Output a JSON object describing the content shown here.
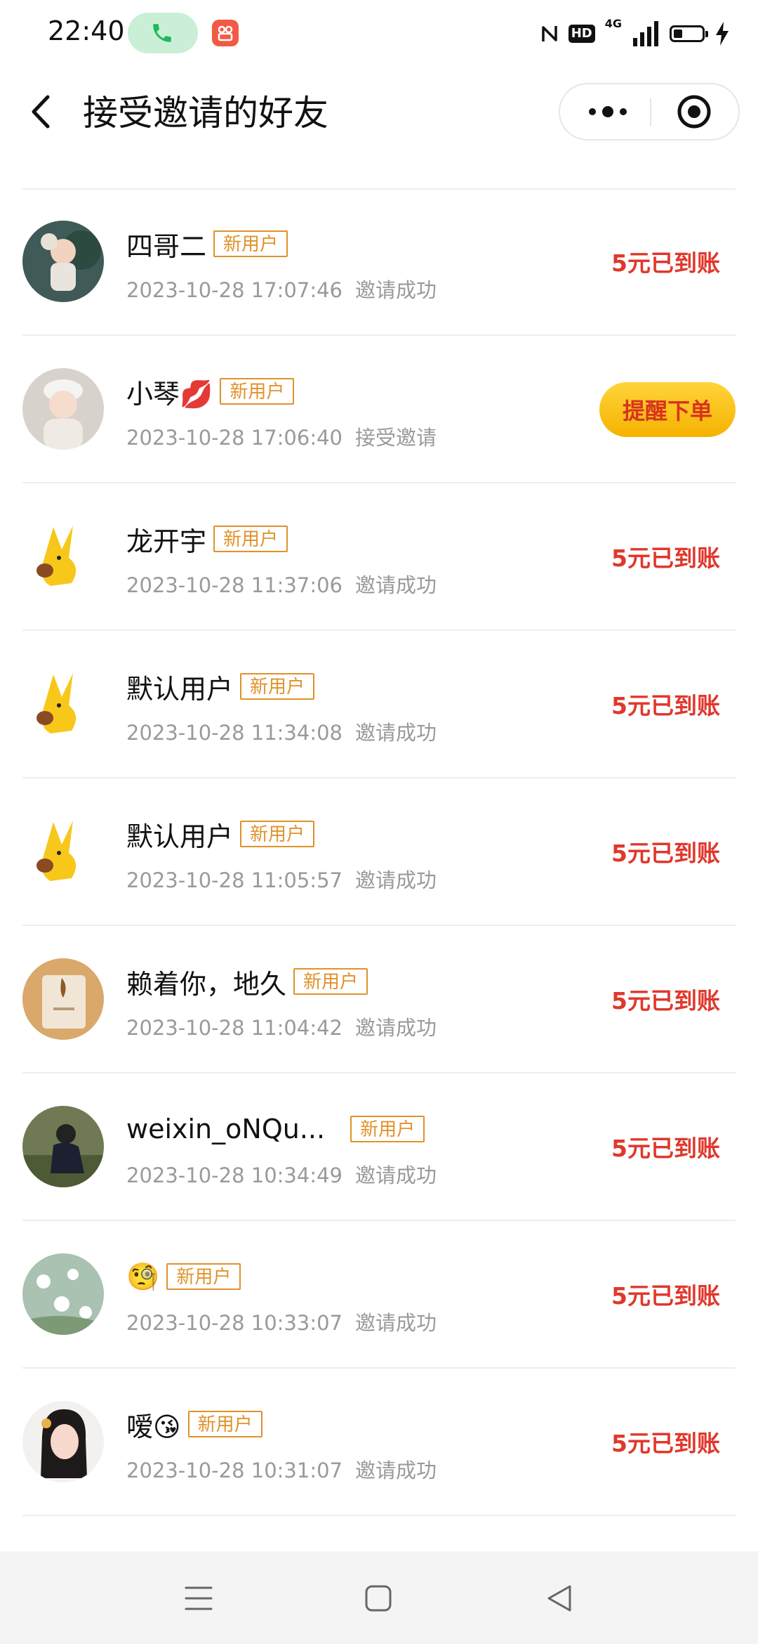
{
  "status_bar": {
    "time": "22:40",
    "hd": "HD",
    "network": "4G"
  },
  "header": {
    "title": "接受邀请的好友"
  },
  "tag_label": "新用户",
  "rows": [
    {
      "name": "四哥二",
      "datetime": "2023-10-28 17:07:46",
      "status": "邀请成功",
      "reward": "5元已到账"
    },
    {
      "name": "小琴💋",
      "datetime": "2023-10-28 17:06:40",
      "status": "接受邀请",
      "action": "提醒下单"
    },
    {
      "name": "龙开宇",
      "datetime": "2023-10-28 11:37:06",
      "status": "邀请成功",
      "reward": "5元已到账"
    },
    {
      "name": "默认用户",
      "datetime": "2023-10-28 11:34:08",
      "status": "邀请成功",
      "reward": "5元已到账"
    },
    {
      "name": "默认用户",
      "datetime": "2023-10-28 11:05:57",
      "status": "邀请成功",
      "reward": "5元已到账"
    },
    {
      "name": "赖着你，地久",
      "datetime": "2023-10-28 11:04:42",
      "status": "邀请成功",
      "reward": "5元已到账"
    },
    {
      "name": "weixin_oNQu...",
      "datetime": "2023-10-28 10:34:49",
      "status": "邀请成功",
      "reward": "5元已到账"
    },
    {
      "name": "🧐",
      "datetime": "2023-10-28 10:33:07",
      "status": "邀请成功",
      "reward": "5元已到账"
    },
    {
      "name": "嗳😘",
      "datetime": "2023-10-28 10:31:07",
      "status": "邀请成功",
      "reward": "5元已到账"
    }
  ],
  "colors": {
    "tag": "#e0922a",
    "reward": "#e0382c",
    "remind_bg": "#f5b200"
  },
  "icons": {
    "back": "chevron-left-icon",
    "more": "more-dots-icon",
    "close": "target-circle-icon"
  }
}
